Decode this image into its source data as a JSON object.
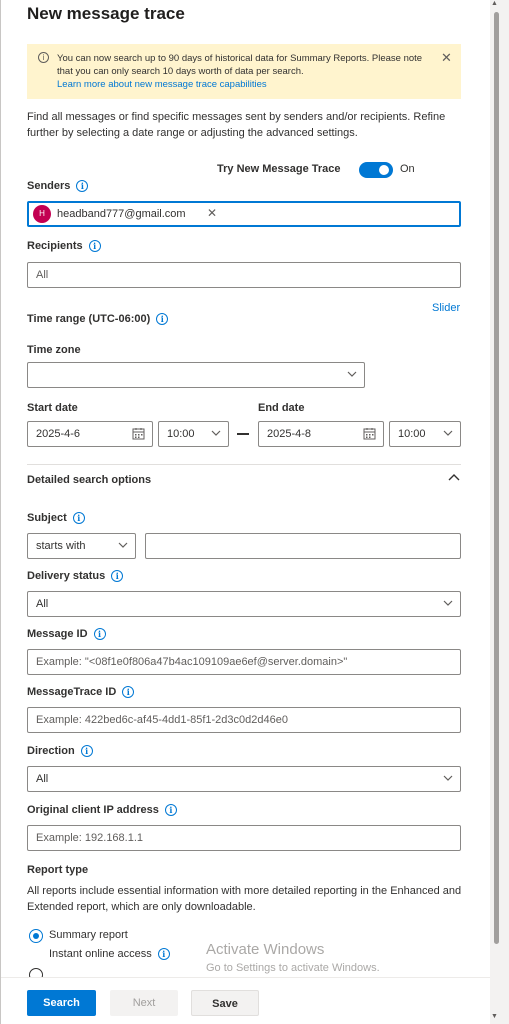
{
  "panel": {
    "title": "New message trace"
  },
  "banner": {
    "icon": "info-icon",
    "text": "You can now search up to 90 days of historical data for Summary Reports. Please note that you can only search 10 days worth of data per search.",
    "link": "Learn more about new message trace capabilities",
    "close": "✕"
  },
  "intro": "Find all messages or find specific messages sent by senders and/or recipients. Refine further by selecting a date range or adjusting the advanced settings.",
  "toggle": {
    "label": "Try New Message Trace",
    "state": "On",
    "on": true
  },
  "senders": {
    "label": "Senders",
    "chip_initial": "H",
    "chip_email": "headband777@gmail.com",
    "chip_remove": "✕"
  },
  "recipients": {
    "label": "Recipients",
    "placeholder": "All"
  },
  "slider_link": "Slider",
  "time_range": {
    "label": "Time range (UTC-06:00)"
  },
  "time_zone": {
    "label": "Time zone",
    "value": ""
  },
  "start": {
    "label": "Start date",
    "date": "2025-4-6",
    "time": "10:00"
  },
  "end": {
    "label": "End date",
    "date": "2025-4-8",
    "time": "10:00"
  },
  "detailed": {
    "label": "Detailed search options",
    "expanded": true
  },
  "subject": {
    "label": "Subject",
    "operator": "starts with",
    "value": ""
  },
  "delivery_status": {
    "label": "Delivery status",
    "value": "All"
  },
  "message_id": {
    "label": "Message ID",
    "placeholder": "Example: \"<08f1e0f806a47b4ac109109ae6ef@server.domain>\""
  },
  "messagetrace_id": {
    "label": "MessageTrace ID",
    "placeholder": "Example: 422bed6c-af45-4dd1-85f1-2d3c0d2d46e0"
  },
  "direction": {
    "label": "Direction",
    "value": "All"
  },
  "client_ip": {
    "label": "Original client IP address",
    "placeholder": "Example: 192.168.1.1"
  },
  "report_type": {
    "label": "Report type",
    "description": "All reports include essential information with more detailed reporting in the Enhanced and Extended report, which are only downloadable.",
    "options": [
      {
        "label": "Summary report",
        "sub": "Instant online access",
        "selected": true
      }
    ]
  },
  "watermark": {
    "line1": "Activate Windows",
    "line2": "Go to Settings to activate Windows."
  },
  "buttons": {
    "search": "Search",
    "next": "Next",
    "save": "Save"
  },
  "colors": {
    "accent": "#0078d4",
    "banner_bg": "#fff4ce",
    "avatar": "#c30052"
  }
}
